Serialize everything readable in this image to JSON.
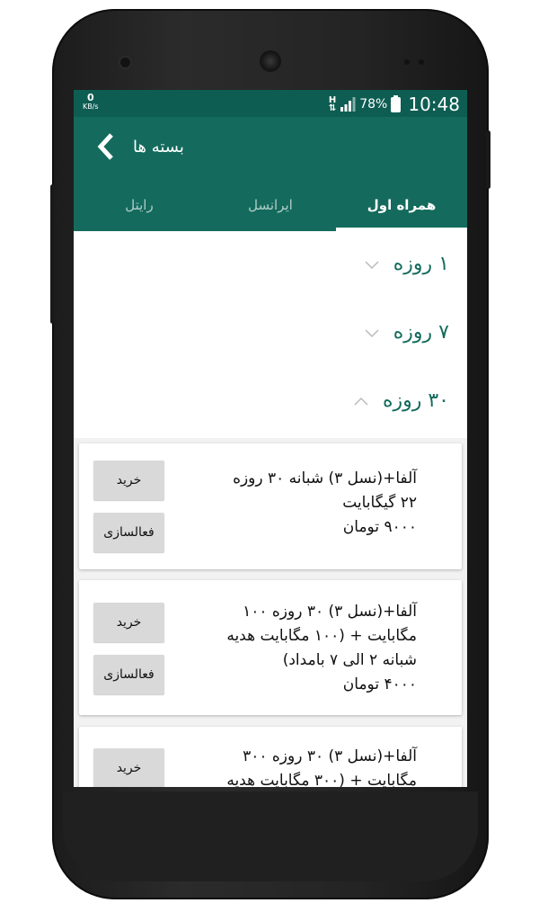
{
  "status_bar": {
    "speed_value": "0",
    "speed_unit": "KB/s",
    "network": "H",
    "battery": "78%",
    "time": "10:48"
  },
  "app_bar": {
    "title": "بسته ها",
    "back_icon": "chevron-left-icon"
  },
  "tabs": [
    {
      "label": "همراه اول",
      "active": true
    },
    {
      "label": "ایرانسل",
      "active": false
    },
    {
      "label": "رایتل",
      "active": false
    }
  ],
  "groups": [
    {
      "title": "۱ روزه",
      "expanded": false
    },
    {
      "title": "۷ روزه",
      "expanded": false
    },
    {
      "title": "۳۰ روزه",
      "expanded": true
    }
  ],
  "packages": [
    {
      "lines": [
        "آلفا+(نسل ۳) شبانه ۳۰ روزه",
        "۲۲ گیگابایت",
        "۹۰۰۰ تومان"
      ],
      "buy_label": "خرید",
      "activate_label": "فعالسازی"
    },
    {
      "lines": [
        "آلفا+(نسل ۳) ۳۰ روزه ۱۰۰",
        "مگابایت + (۱۰۰ مگابایت هدیه",
        "شبانه ۲ الی ۷ بامداد)",
        "۴۰۰۰ تومان"
      ],
      "buy_label": "خرید",
      "activate_label": "فعالسازی"
    },
    {
      "lines": [
        "آلفا+(نسل ۳) ۳۰ روزه ۳۰۰",
        "مگابایت + (۳۰۰ مگابایت هدیه"
      ],
      "buy_label": "خرید"
    }
  ],
  "colors": {
    "primary": "#146b5d",
    "status_bar": "#0e5d52",
    "button": "#d9d9d9"
  }
}
